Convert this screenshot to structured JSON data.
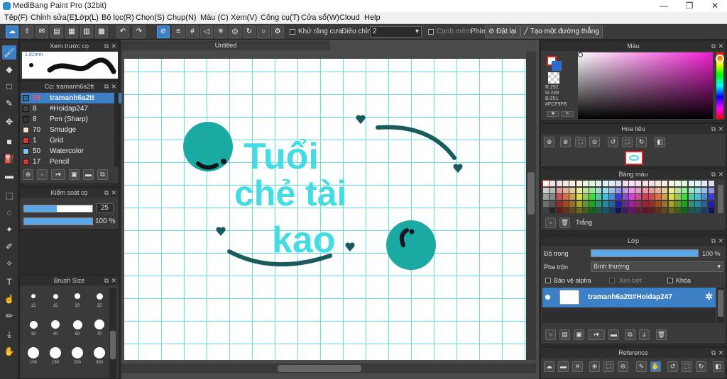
{
  "app": {
    "title": "MediBang Paint Pro (32bit)",
    "window_controls": [
      "—",
      "❐",
      "✕"
    ]
  },
  "menu": [
    "Tệp(F)",
    "Chỉnh sửa(E)",
    "Lớp(L)",
    "Bộ lọc(R)",
    "Chọn(S)",
    "Chụp(N)",
    "Màu (C)",
    "Xem(V)",
    "Công cụ(T)",
    "Cửa sổ(W)",
    "Cloud",
    "Help"
  ],
  "toolbar": {
    "antialias_label": "Khử răng cưa",
    "correction_label": "Điều chỉnh",
    "correction_value": "2",
    "sharp_edge_label": "Cạnh mềm",
    "keys_label": "Phím",
    "reset_label": "Đặt lại",
    "straight_line_label": "Tạo một đường thẳng"
  },
  "brush_preview": {
    "title": "Xem trước cọ",
    "size": "1.81mm"
  },
  "brush_panel": {
    "title": "Cọ: tramanh6a2tt",
    "brushes": [
      {
        "size": "25",
        "name": "tramanh6a2tt",
        "color": "#2a6f93"
      },
      {
        "size": "8",
        "name": "#Hoidap247",
        "color": "#444444"
      },
      {
        "size": "8",
        "name": "Pen (Sharp)",
        "color": "#333333"
      },
      {
        "size": "70",
        "name": "Smudge",
        "color": "#f3e2c8"
      },
      {
        "size": "1",
        "name": "Grid",
        "color": "#d23a3a"
      },
      {
        "size": "50",
        "name": "Watercolor",
        "color": "#7fc9f0"
      },
      {
        "size": "17",
        "name": "Pencil",
        "color": "#d23a3a"
      }
    ]
  },
  "brush_control": {
    "title": "Kiểm soát cọ",
    "size": "25",
    "opacity": "100 %",
    "size_level": 0.48,
    "opacity_level": 1.0
  },
  "brush_size": {
    "title": "Brush Size",
    "sizes": [
      "12",
      "15",
      "20",
      "25",
      "30",
      "40",
      "50",
      "70",
      "100",
      "150",
      "200",
      "300"
    ]
  },
  "document": {
    "tab": "Untitled",
    "text_lines": [
      "Tuổi",
      "chẻ tài",
      "kao"
    ],
    "ink_color": "#1a5b5b",
    "teal": "#1aa9a3",
    "text_color": "#44dce3"
  },
  "color_panel": {
    "title": "Màu",
    "r": "R:252",
    "g": "G:249",
    "b": "B:251",
    "hex": "#FCF9FB"
  },
  "navigator": {
    "title": "Hoa tiêu"
  },
  "palette": {
    "title": "Bảng màu",
    "selected_name": "Trắng"
  },
  "layer_panel": {
    "title": "Lớp",
    "opacity_label": "Độ trong",
    "opacity_value": "100 %",
    "opacity_level": 1.0,
    "blend_label": "Pha trộn",
    "blend_value": "Bình thường",
    "protect_alpha": "Bảo vệ alpha",
    "clipping": "Xén bớt",
    "lock": "Khóa",
    "layer_name": "tramanh6a2tt#Hoidap247"
  },
  "reference": {
    "title": "Reference"
  }
}
